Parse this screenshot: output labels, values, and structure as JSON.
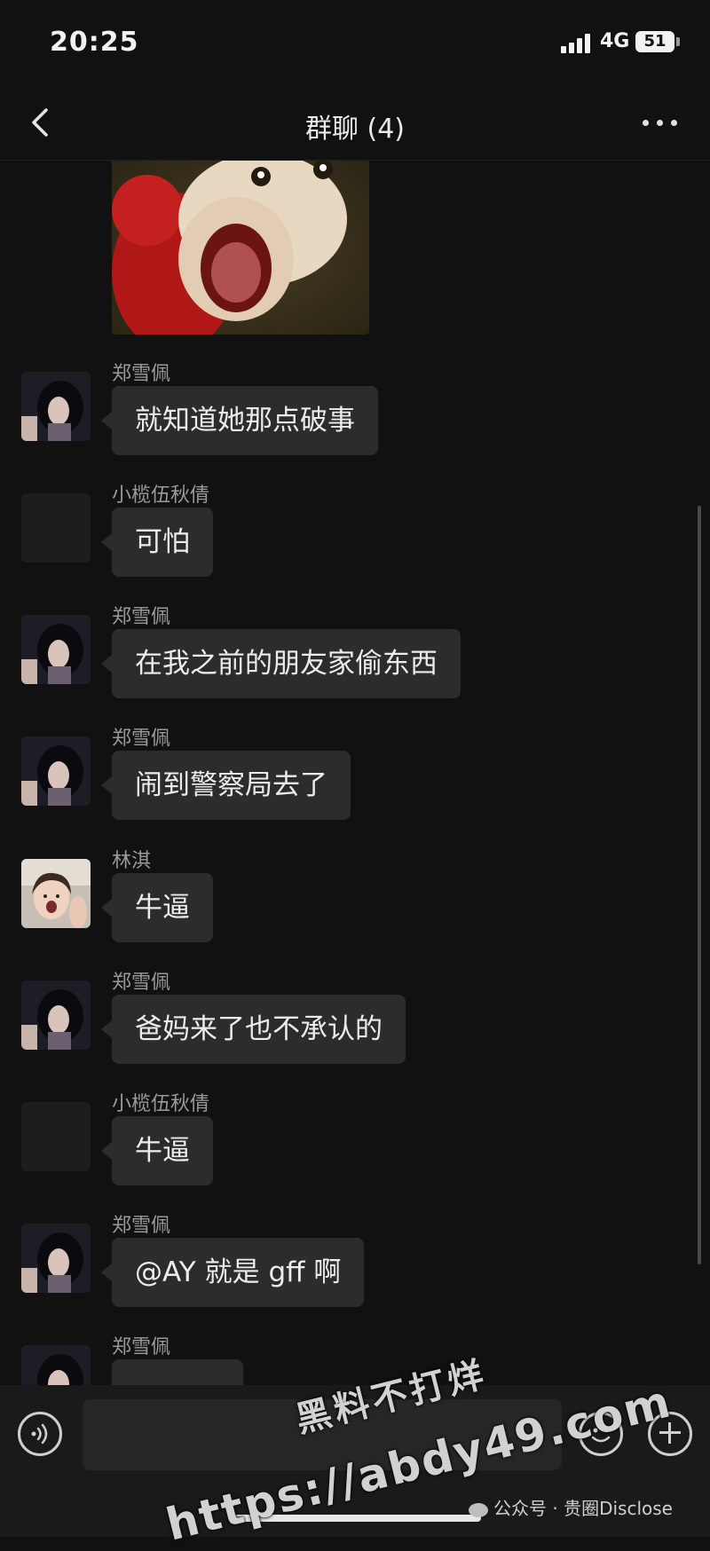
{
  "status_bar": {
    "time": "20:25",
    "network": "4G",
    "battery": "51"
  },
  "nav": {
    "title": "群聊 (4)"
  },
  "messages": [
    {
      "sender": "郑雪佩",
      "text": "就知道她那点破事"
    },
    {
      "sender": "小榄伍秋倩",
      "text": "可怕"
    },
    {
      "sender": "郑雪佩",
      "text": "在我之前的朋友家偷东西"
    },
    {
      "sender": "郑雪佩",
      "text": "闹到警察局去了"
    },
    {
      "sender": "林淇",
      "text": "牛逼"
    },
    {
      "sender": "郑雪佩",
      "text": "爸妈来了也不承认的"
    },
    {
      "sender": "小榄伍秋倩",
      "text": "牛逼"
    },
    {
      "sender": "郑雪佩",
      "text": "@AY 就是 gff 啊"
    },
    {
      "sender": "郑雪佩",
      "text": ""
    }
  ],
  "watermark": {
    "title": "黑料不打烊",
    "url": "https://abdy49.com",
    "credit": "公众号 · 贵圈Disclose"
  },
  "icons": {
    "back": "chevron-left-icon",
    "more": "more-dots-icon",
    "voice": "voice-icon",
    "emoji": "emoji-icon",
    "plus": "plus-icon"
  },
  "colors": {
    "background": "#111111",
    "bubble": "#2c2c2c",
    "input_bar": "#1a1a1a"
  }
}
